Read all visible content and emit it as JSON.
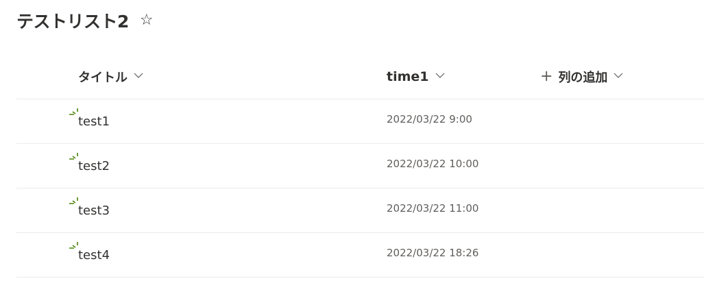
{
  "list": {
    "title": "テストリスト2",
    "favorite_glyph": "☆"
  },
  "columns": [
    {
      "label": "タイトル"
    },
    {
      "label": "time1"
    },
    {
      "label": "列の追加",
      "prefix": "+"
    }
  ],
  "rows": [
    {
      "title": "test1",
      "time1": "2022/03/22 9:00"
    },
    {
      "title": "test2",
      "time1": "2022/03/22 10:00"
    },
    {
      "title": "test3",
      "time1": "2022/03/22 11:00"
    },
    {
      "title": "test4",
      "time1": "2022/03/22 18:26"
    }
  ],
  "icons": {
    "favorite": "star-outline-icon",
    "sort": "chevron-down-icon",
    "add": "plus-icon",
    "new_item": "new-item-burst-icon"
  },
  "colors": {
    "new_item_accent": "#498205",
    "divider": "#edebe9"
  }
}
